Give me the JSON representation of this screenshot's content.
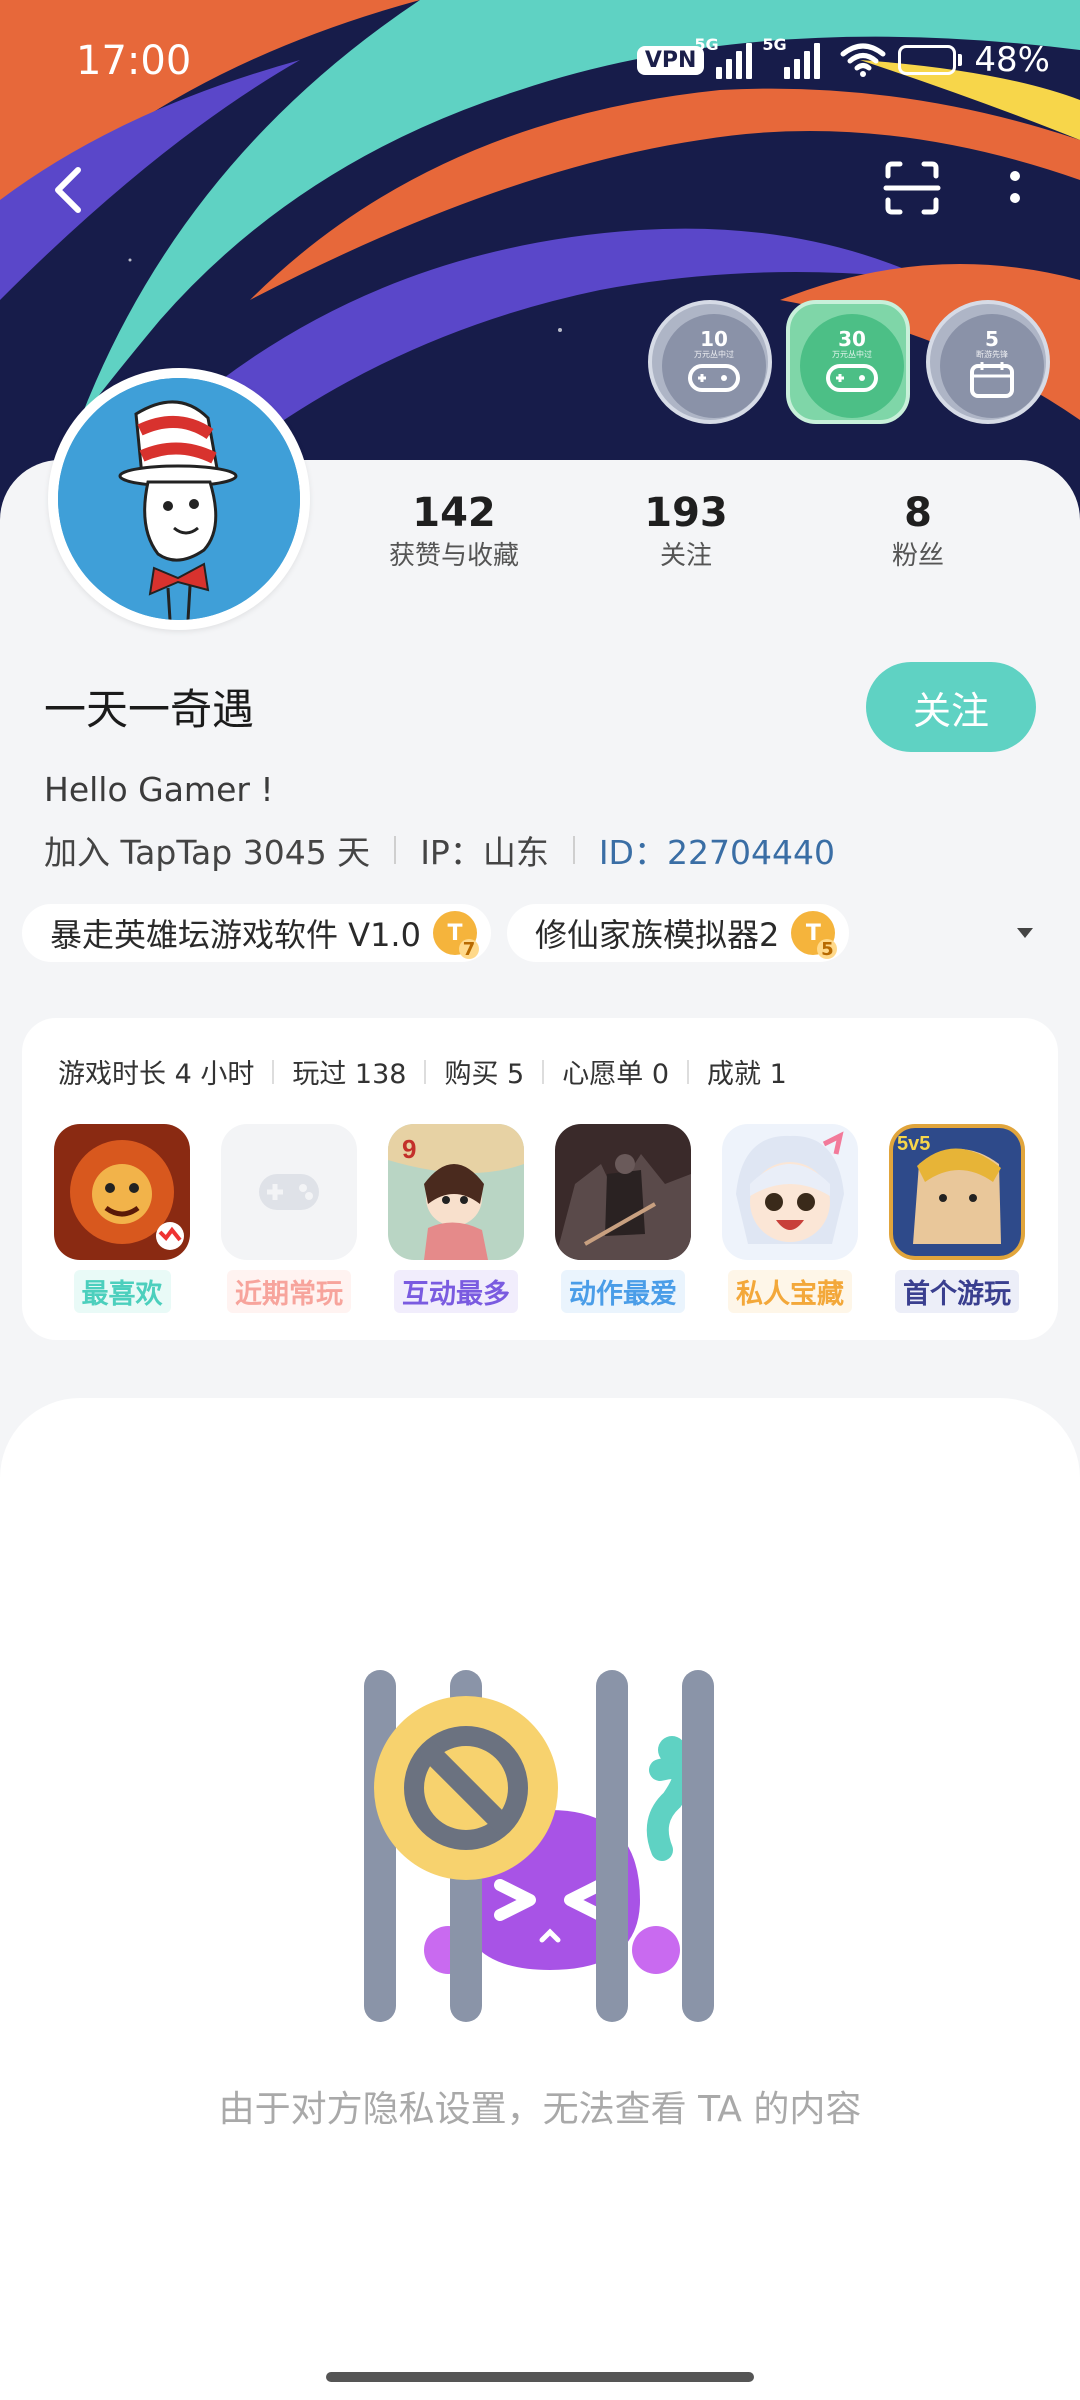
{
  "status": {
    "time": "17:00",
    "vpn": "VPN",
    "net1": "5G",
    "net2": "5G",
    "battery": "48%"
  },
  "medals": [
    {
      "num": "10",
      "sub": "万元丛中过"
    },
    {
      "num": "30",
      "sub": "万元丛中过"
    },
    {
      "num": "5",
      "sub": "断游先锋"
    }
  ],
  "stats": [
    {
      "value": "142",
      "label": "获赞与收藏"
    },
    {
      "value": "193",
      "label": "关注"
    },
    {
      "value": "8",
      "label": "粉丝"
    }
  ],
  "profile": {
    "name": "一天一奇遇",
    "follow_label": "关注",
    "bio": "Hello Gamer !",
    "join": "加入 TapTap 3045 天",
    "ip": "IP：山东",
    "id_label": "ID：",
    "id_value": "22704440"
  },
  "tags": [
    {
      "label": "暴走英雄坛游戏软件 V1.0",
      "level": "7"
    },
    {
      "label": "修仙家族模拟器2",
      "level": "5"
    }
  ],
  "game_stats": [
    "游戏时长 4 小时",
    "玩过 138",
    "购买 5",
    "心愿单 0",
    "成就 1"
  ],
  "games": [
    {
      "label": "最喜欢",
      "color": "#4ccfbd"
    },
    {
      "label": "近期常玩",
      "color": "#f7a49c"
    },
    {
      "label": "互动最多",
      "color": "#7a5be0"
    },
    {
      "label": "动作最爱",
      "color": "#4a9de8"
    },
    {
      "label": "私人宝藏",
      "color": "#f3a83a"
    },
    {
      "label": "首个游玩",
      "color": "#3a3f8f"
    }
  ],
  "privacy_text": "由于对方隐私设置，无法查看 TA 的内容",
  "colors": {
    "accent": "#5fd2c3",
    "banner_bg": "#171c4a"
  }
}
